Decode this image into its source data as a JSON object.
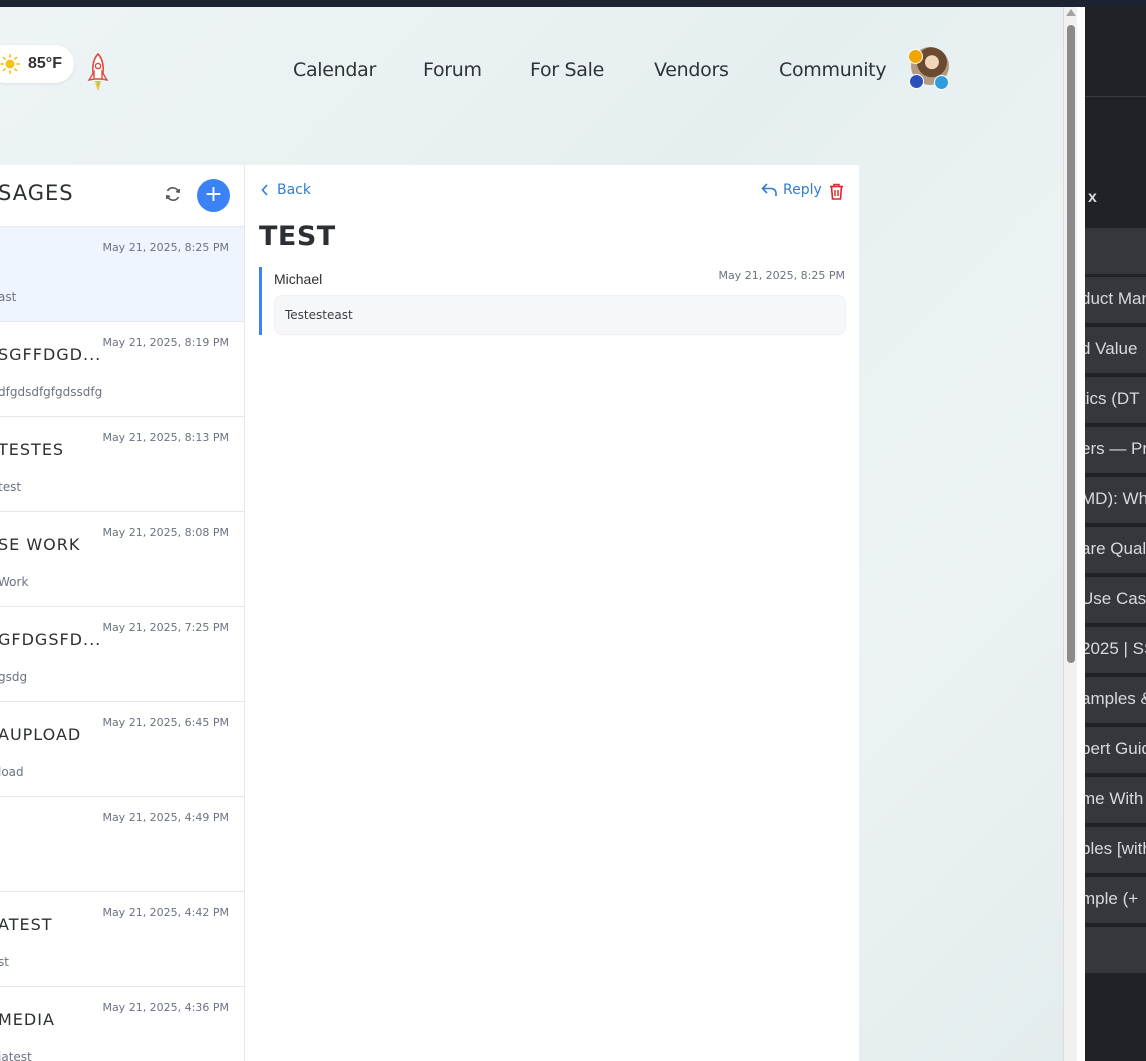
{
  "header": {
    "weather": {
      "temperature": "85°F"
    },
    "nav": [
      "Calendar",
      "Forum",
      "For Sale",
      "Vendors",
      "Community"
    ]
  },
  "messages_panel": {
    "title": "SAGES",
    "items": [
      {
        "subject": "",
        "date": "May 21, 2025, 8:25 PM",
        "preview": "ast",
        "active": true
      },
      {
        "subject": "SGFFDGD...",
        "date": "May 21, 2025, 8:19 PM",
        "preview": "dfgdsdfgfgdssdfg"
      },
      {
        "subject": "TESTES",
        "date": "May 21, 2025, 8:13 PM",
        "preview": "test"
      },
      {
        "subject": "SE WORK",
        "date": "May 21, 2025, 8:08 PM",
        "preview": "Work"
      },
      {
        "subject": "GFDGSFD...",
        "date": "May 21, 2025, 7:25 PM",
        "preview": "gsdg"
      },
      {
        "subject": "AUPLOAD",
        "date": "May 21, 2025, 6:45 PM",
        "preview": "load"
      },
      {
        "subject": "",
        "date": "May 21, 2025, 4:49 PM",
        "preview": ""
      },
      {
        "subject": "ATEST",
        "date": "May 21, 2025, 4:42 PM",
        "preview": "st"
      },
      {
        "subject": "MEDIA",
        "date": "May 21, 2025, 4:36 PM",
        "preview": "iatest"
      }
    ]
  },
  "detail": {
    "back_label": "Back",
    "reply_label": "Reply",
    "title": "TEST",
    "sender": "Michael",
    "date": "May 21, 2025, 8:25 PM",
    "body": "Testesteast"
  },
  "side_panel": {
    "label": "x",
    "rows": [
      "duct Man",
      "d Value",
      "tics (DT",
      "ers — Pr",
      "MD): Wh",
      "are Qual",
      "Use Case",
      "2025 | SS",
      "amples &",
      "pert Guid",
      "me With",
      "bles [with",
      "mple (+"
    ]
  },
  "colors": {
    "accent": "#3b82f6",
    "link": "#2f7dd4",
    "danger": "#dc2626",
    "active_row": "#eef5fe"
  }
}
